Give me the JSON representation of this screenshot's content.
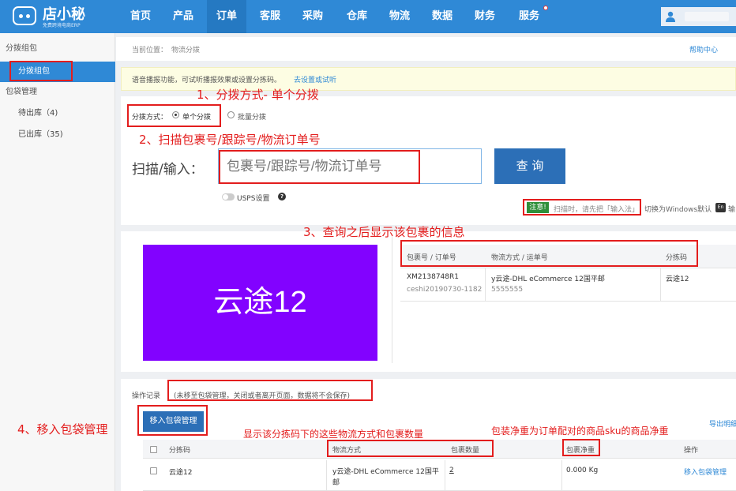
{
  "app": {
    "logo_name": "店小秘",
    "logo_tagline": "免费跨境电商ERP"
  },
  "nav": {
    "items": [
      "首页",
      "产品",
      "订单",
      "客服",
      "采购",
      "仓库",
      "物流",
      "数据",
      "财务",
      "服务"
    ],
    "active": "订单"
  },
  "sidebar": {
    "group1": "分拨组包",
    "item1": "分拨组包",
    "group2": "包袋管理",
    "item2": "待出库（4)",
    "item3": "已出库（35)"
  },
  "breadcrumb": {
    "label": "当前位置：",
    "page": "物流分拨"
  },
  "help_link": "帮助中心",
  "notice": {
    "text": "语音播报功能，可试听播报效果或设置分拣码。",
    "link": "去设置或试听"
  },
  "mode": {
    "label": "分拨方式：",
    "single": "单个分拨",
    "batch": "批量分拨",
    "selected": "single"
  },
  "scan": {
    "label": "扫描/输入：",
    "placeholder": "包裹号/跟踪号/物流订单号",
    "query_button": "查 询"
  },
  "usps": {
    "label": "USPS设置",
    "on": false
  },
  "note": {
    "badge": "注意!",
    "text": "扫描时，请先把「输入法」",
    "switch_text": "切换为Windows默认",
    "en_icon": "En",
    "trail": "输"
  },
  "sort_code_display": "云途12",
  "package_table": {
    "headers": [
      "包裹号 / 订单号",
      "物流方式 / 运单号",
      "分拣码"
    ],
    "row": {
      "package_no": "XM2138748R1",
      "order_no": "ceshi20190730-1182",
      "logistics": "y云途-DHL eCommerce 12国平邮",
      "waybill": "5555555",
      "sort_code": "云途12"
    }
  },
  "op_record": {
    "label": "操作记录",
    "hint": "(未移至包袋管理，关闭或者离开页面，数据将不会保存)"
  },
  "move_button": "移入包袋管理",
  "export_link": "导出明细",
  "summary_table": {
    "headers": [
      "分拣码",
      "物流方式",
      "包裹数量",
      "包裹净重",
      "操作"
    ],
    "rows": [
      {
        "sort_code": "云途12",
        "logistics": "y云途-DHL eCommerce 12国平邮",
        "count": "2",
        "weight": "0.000 Kg",
        "action": "移入包袋管理"
      }
    ]
  },
  "annotations": {
    "a1": "1、分拨方式- 单个分拨",
    "a2": "2、扫描包裹号/跟踪号/物流订单号",
    "a3": "3、查询之后显示该包裹的信息",
    "a4": "4、移入包袋管理",
    "a5": "显示该分拣码下的这些物流方式和包裹数量",
    "a6": "包装净重为订单配对的商品sku的商品净重"
  }
}
